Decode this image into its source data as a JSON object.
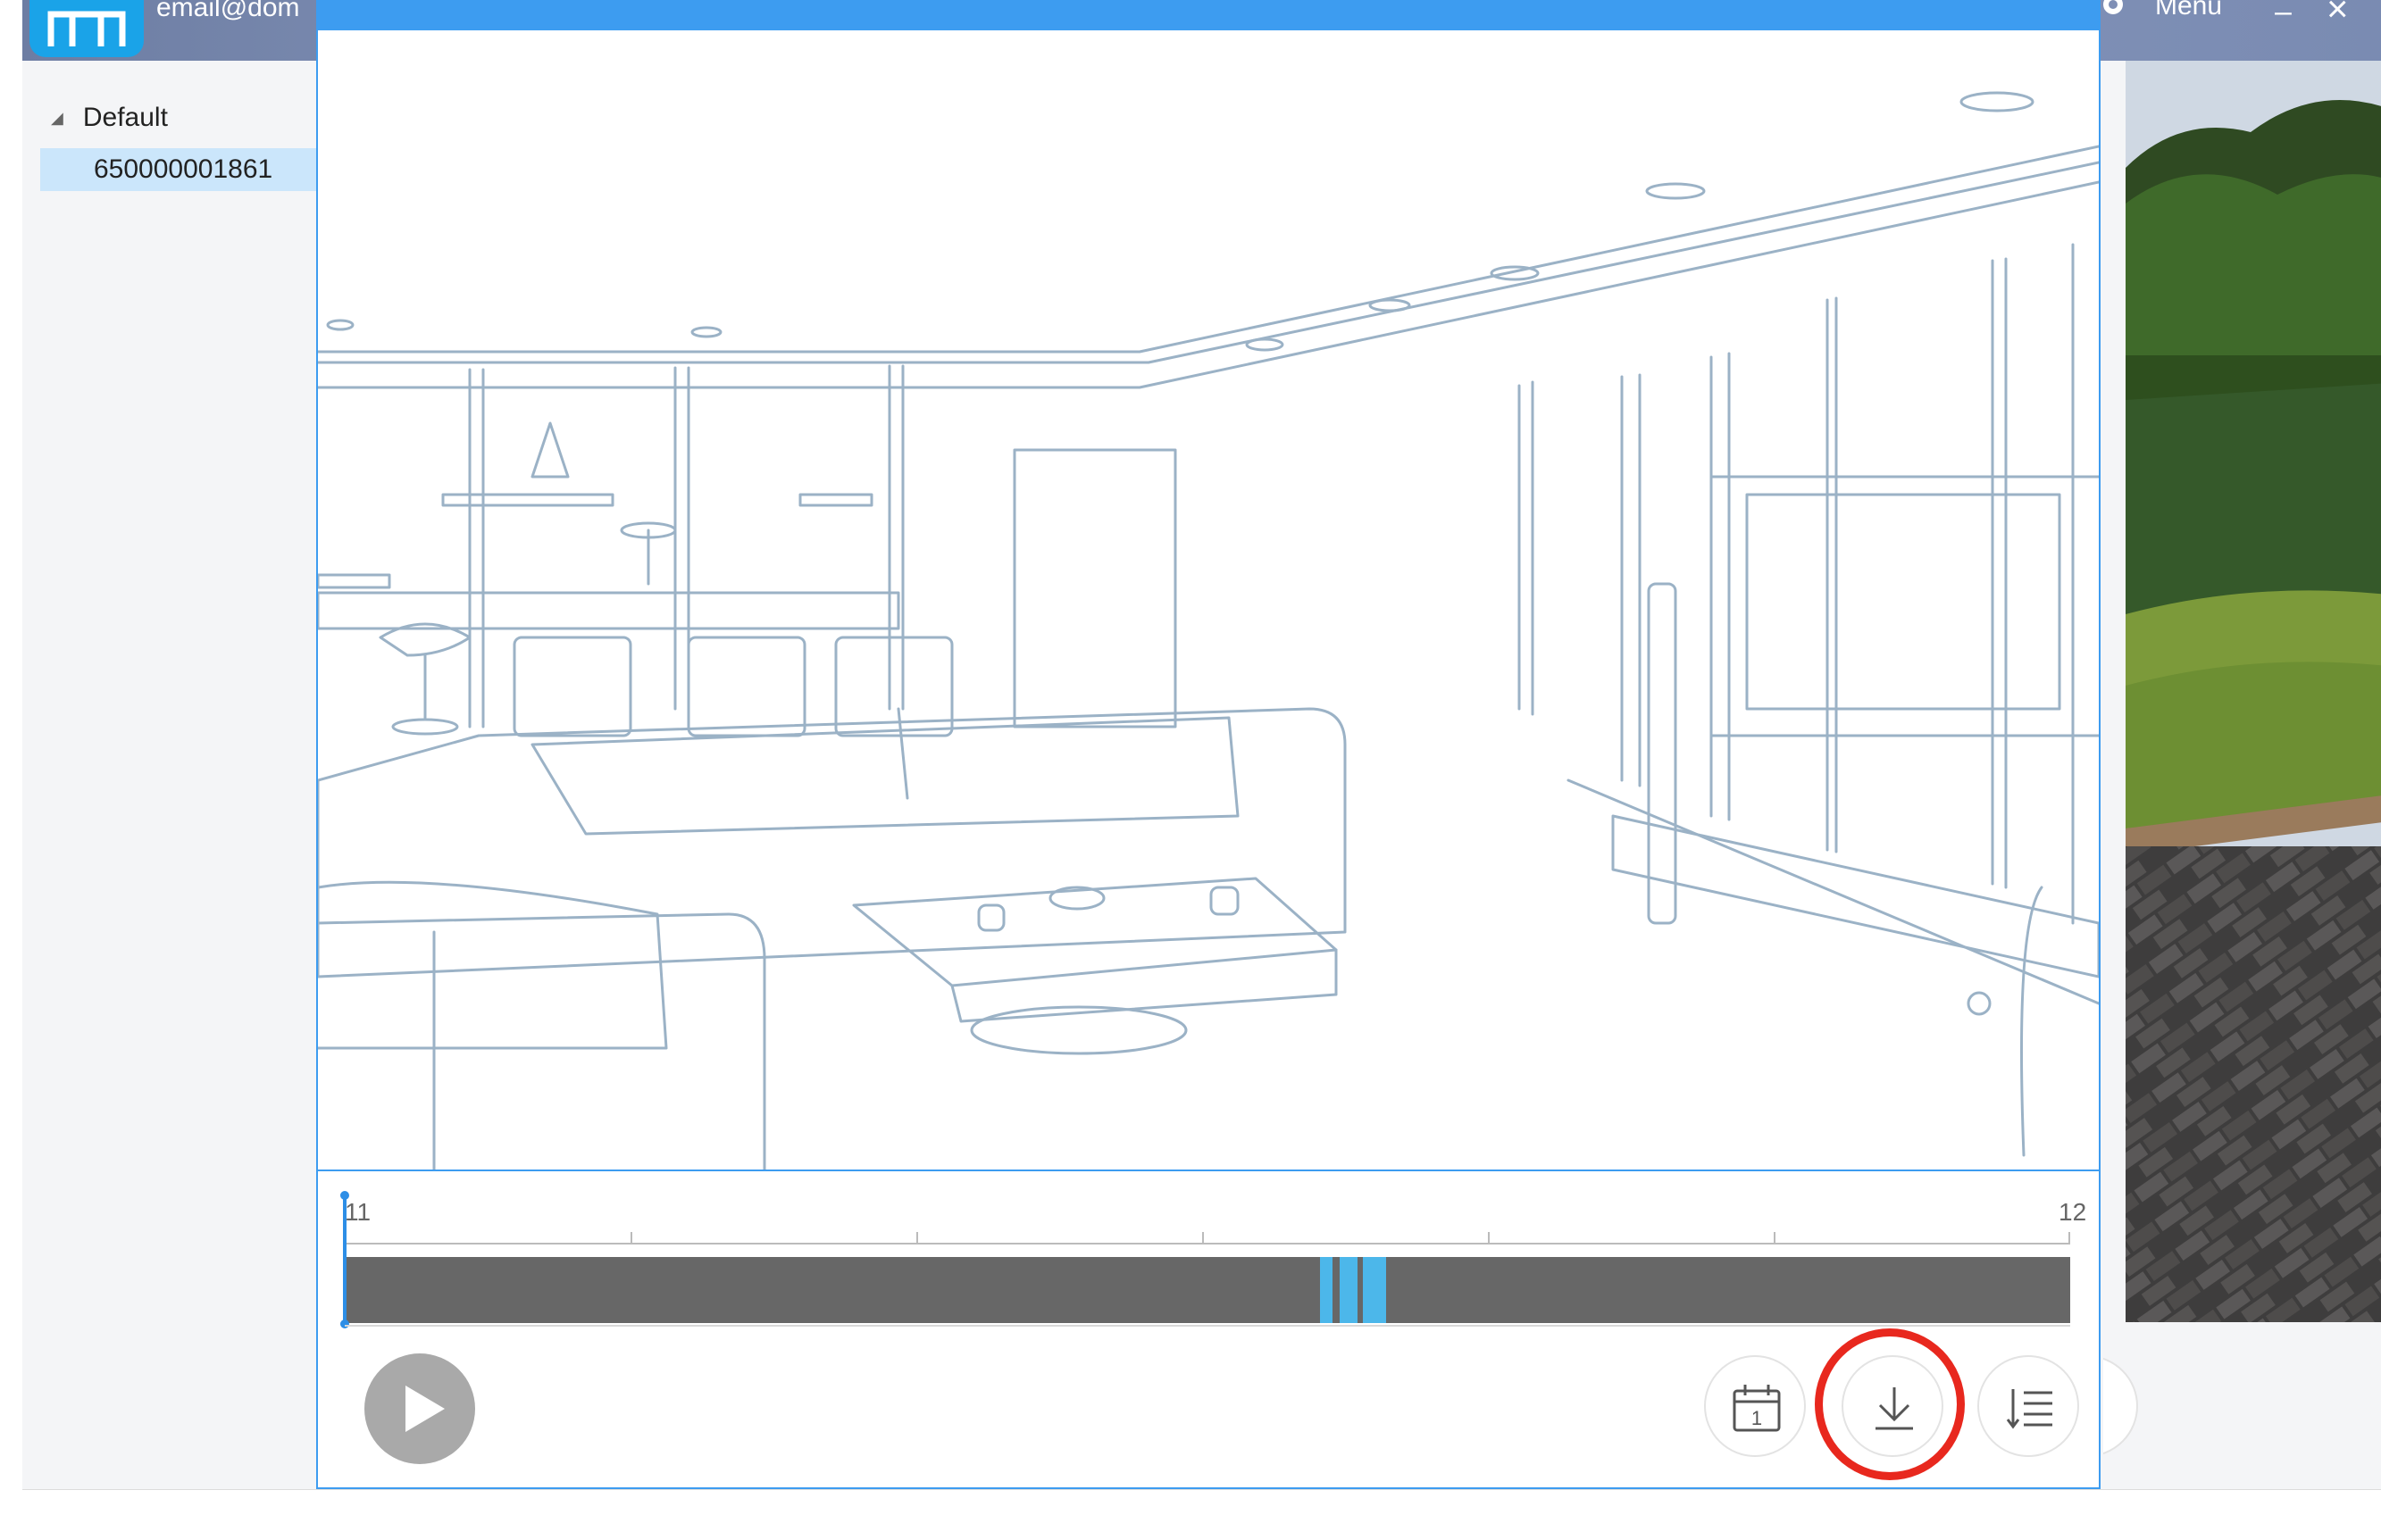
{
  "app": {
    "user_email": "email@dom",
    "menu_label": "Menu",
    "device_tree": {
      "group_label": "Default",
      "device_label": "650000001861"
    }
  },
  "playback": {
    "timeline": {
      "start_label": "11",
      "end_label": "12"
    },
    "controls": {
      "play": "play-icon",
      "calendar": "calendar-icon",
      "calendar_day": "1",
      "download": "download-icon",
      "list": "list-icon"
    }
  },
  "colors": {
    "accent": "#3d9cf0",
    "recording_segment": "#4cb7ea",
    "timeline_track": "#676767",
    "highlight_circle": "#e8281e"
  }
}
